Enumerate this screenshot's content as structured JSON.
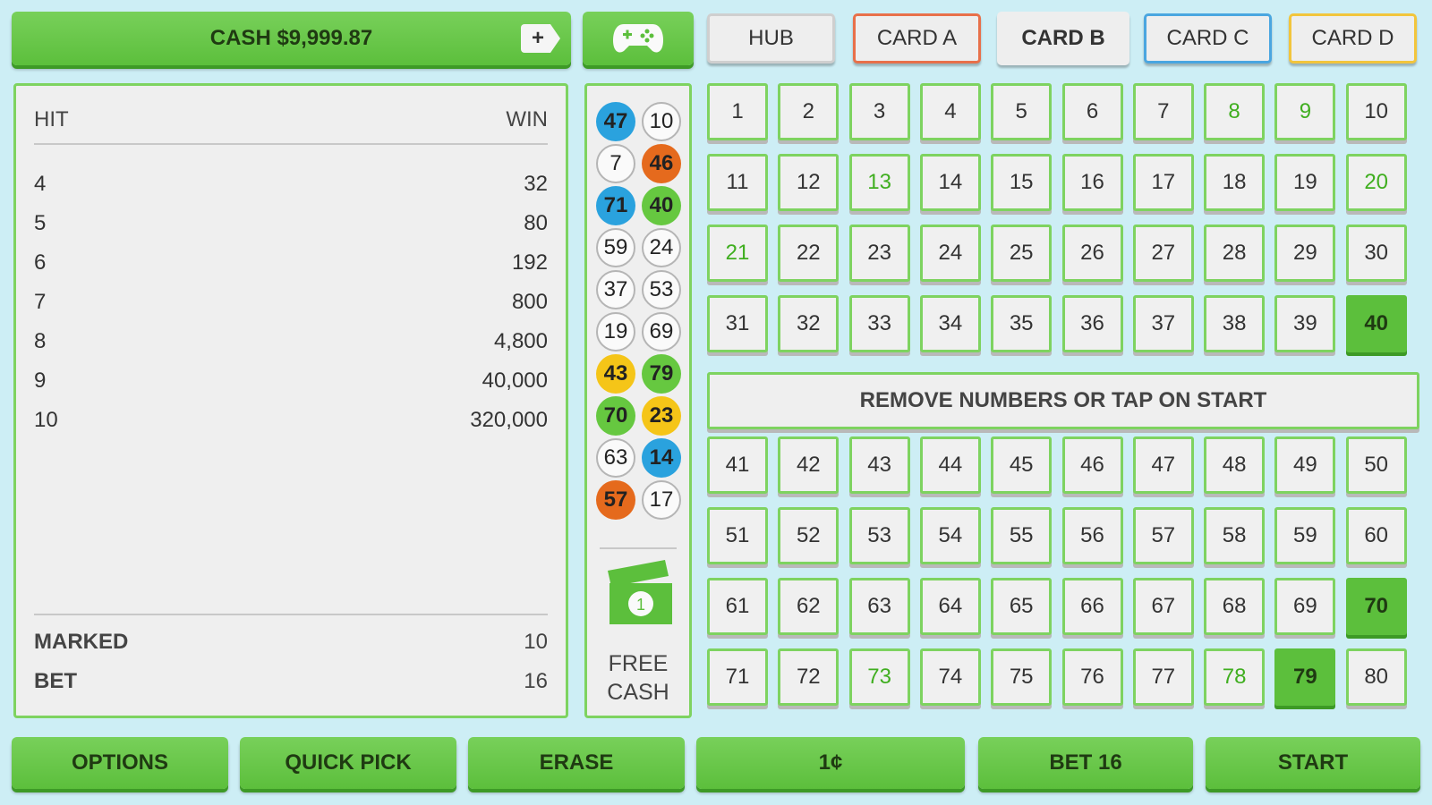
{
  "top": {
    "cash_label": "CASH $9,999.87",
    "plus_label": "+",
    "tabs": [
      "HUB",
      "CARD A",
      "CARD B",
      "CARD C",
      "CARD D"
    ]
  },
  "paytable": {
    "hit_header": "HIT",
    "win_header": "WIN",
    "rows": [
      {
        "hit": "4",
        "win": "32"
      },
      {
        "hit": "5",
        "win": "80"
      },
      {
        "hit": "6",
        "win": "192"
      },
      {
        "hit": "7",
        "win": "800"
      },
      {
        "hit": "8",
        "win": "4,800"
      },
      {
        "hit": "9",
        "win": "40,000"
      },
      {
        "hit": "10",
        "win": "320,000"
      }
    ],
    "marked_label": "MARKED",
    "marked_value": "10",
    "bet_label": "BET",
    "bet_value": "16"
  },
  "drawn_balls": [
    {
      "n": "47",
      "color": "blue"
    },
    {
      "n": "10",
      "color": "plain"
    },
    {
      "n": "7",
      "color": "plain"
    },
    {
      "n": "46",
      "color": "orange"
    },
    {
      "n": "71",
      "color": "blue"
    },
    {
      "n": "40",
      "color": "green"
    },
    {
      "n": "59",
      "color": "plain"
    },
    {
      "n": "24",
      "color": "plain"
    },
    {
      "n": "37",
      "color": "plain"
    },
    {
      "n": "53",
      "color": "plain"
    },
    {
      "n": "19",
      "color": "plain"
    },
    {
      "n": "69",
      "color": "plain"
    },
    {
      "n": "43",
      "color": "yellow"
    },
    {
      "n": "79",
      "color": "green"
    },
    {
      "n": "70",
      "color": "green"
    },
    {
      "n": "23",
      "color": "yellow"
    },
    {
      "n": "63",
      "color": "plain"
    },
    {
      "n": "14",
      "color": "blue"
    },
    {
      "n": "57",
      "color": "orange"
    },
    {
      "n": "17",
      "color": "plain"
    }
  ],
  "free_cash": {
    "badge": "1",
    "line1": "FREE",
    "line2": "CASH"
  },
  "board": {
    "hit_numbers": [
      8,
      9,
      13,
      20,
      21,
      73,
      78
    ],
    "selected_numbers": [
      40,
      70,
      79
    ],
    "message": "REMOVE NUMBERS OR TAP ON START"
  },
  "bottom": {
    "options": "OPTIONS",
    "quick_pick": "QUICK PICK",
    "erase": "ERASE",
    "denomination": "1¢",
    "bet": "BET 16",
    "start": "START"
  },
  "colors": {
    "accent_green": "#5cbf3c",
    "hit_text_green": "#3fae1f",
    "ball_blue": "#2aa2de",
    "ball_orange": "#e56a1d",
    "ball_yellow": "#f5c518",
    "background": "#cdeef5"
  }
}
